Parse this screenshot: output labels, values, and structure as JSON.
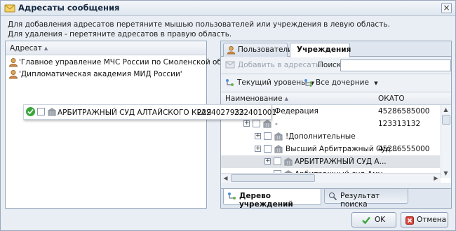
{
  "window": {
    "title": "Адресаты сообщения",
    "close_glyph": "×"
  },
  "info": {
    "line1": "Для добавления адресатов перетяните мышью пользователей или учреждения в левую область.",
    "line2": "Для удаления - перетяните адресатов в правую область."
  },
  "left_grid": {
    "column": "Адресат",
    "rows": [
      {
        "label": "'Главное управление МЧС России по Смоленской области'",
        "icon": "user-icon"
      },
      {
        "label": "'Дипломатическая академия МИД России'",
        "icon": "user-icon"
      }
    ]
  },
  "right_tabs": [
    {
      "label": "Пользователи",
      "icon": "user-icon",
      "active": false
    },
    {
      "label": "Учреждения",
      "active": true
    }
  ],
  "toolbar": {
    "add_label": "Добавить в адресаты",
    "search_label": "Поиск",
    "search_value": "",
    "level_label": "Текущий уровень",
    "children_label": "Все дочерние"
  },
  "tree": {
    "col_name": "Наименование",
    "col_okato": "ОКАТО",
    "rows": [
      {
        "name": "Российская Федерация",
        "okato": "45286585000"
      },
      {
        "name": "-",
        "okato": "123313132"
      },
      {
        "name": "!Дополнительные",
        "okato": ""
      },
      {
        "name": "Высший Арбитражный Суд...",
        "okato": "45286555000"
      },
      {
        "name": "АРБИТРАЖНЫЙ СУД А...",
        "okato": ""
      },
      {
        "name": "Арбитражный суд Аму...",
        "okato": ""
      }
    ],
    "expander": "+"
  },
  "bottom_tabs": [
    {
      "label": "Дерево учреждений",
      "active": true
    },
    {
      "label": "Результат поиска",
      "active": false
    }
  ],
  "buttons": {
    "ok": "OK",
    "cancel": "Отмена"
  },
  "drag_ghost": {
    "name": "АРБИТРАЖНЫЙ СУД АЛТАЙСКОГО КРАЯ",
    "inn": "2224027933",
    "kpp": "222401001"
  },
  "colors": {
    "accent": "#15283f",
    "ok_green": "#3aa63a",
    "cancel_red": "#c0392b",
    "selected_row": "#dfe3e8"
  }
}
